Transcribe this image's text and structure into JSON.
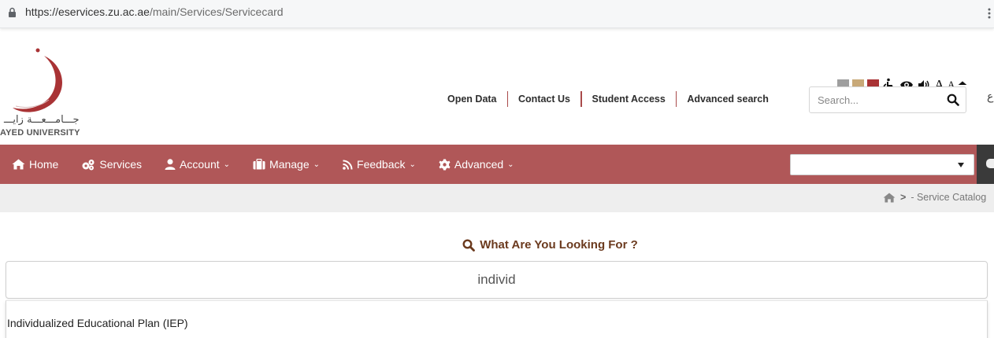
{
  "browser": {
    "url_host": "https://eservices.zu.ac.ae",
    "url_path": "/main/Services/Servicecard"
  },
  "logo": {
    "arabic_text": "جـــامـــعـــة زايـــ",
    "english_text": "AYED UNIVERSITY"
  },
  "accessibility": {
    "swatch_colors": [
      "#9e9e9e",
      "#c8a978",
      "#a93335"
    ],
    "font_large": "A",
    "font_small": "A"
  },
  "top_links": [
    {
      "label": "Open Data"
    },
    {
      "label": "Contact Us"
    },
    {
      "label": "Student Access"
    },
    {
      "label": "Advanced search"
    }
  ],
  "search": {
    "placeholder": "Search...",
    "language_toggle": "ع"
  },
  "nav": {
    "items": [
      {
        "label": "Home",
        "icon": "home-icon",
        "dropdown": false
      },
      {
        "label": "Services",
        "icon": "cogs-icon",
        "dropdown": false
      },
      {
        "label": "Account",
        "icon": "user-icon",
        "dropdown": true
      },
      {
        "label": "Manage",
        "icon": "briefcase-icon",
        "dropdown": true
      },
      {
        "label": "Feedback",
        "icon": "rss-icon",
        "dropdown": true
      },
      {
        "label": "Advanced",
        "icon": "gear-icon",
        "dropdown": true
      }
    ],
    "select_value": ""
  },
  "breadcrumb": {
    "separator": ">",
    "current": "- Service Catalog"
  },
  "finder": {
    "heading": "What Are You Looking For ?",
    "query_value": "individ",
    "results": [
      {
        "label": "Individualized Educational Plan (IEP)"
      }
    ]
  },
  "colors": {
    "nav_bg": "#b05758",
    "accent": "#a94a4a",
    "heading": "#6b3a1e"
  }
}
